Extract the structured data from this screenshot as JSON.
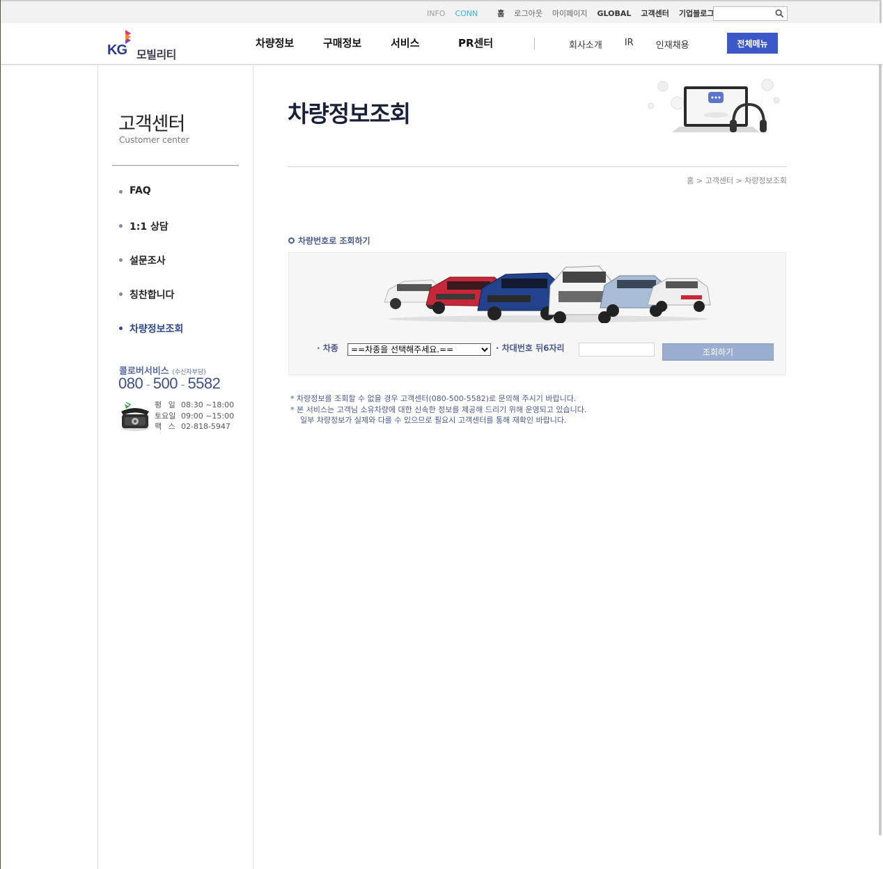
{
  "util_bar": {
    "infoconn_a": "INFO",
    "infoconn_b": "CONN",
    "links": [
      "홈",
      "로그아웃",
      "마이페이지",
      "GLOBAL",
      "고객센터",
      "기업블로그"
    ],
    "search_placeholder": ""
  },
  "header": {
    "logo_kg": "KG",
    "logo_brand": "모빌리티",
    "gnb": [
      "차량정보",
      "구매정보",
      "서비스",
      "PR센터"
    ],
    "sub_nav": [
      "회사소개",
      "IR",
      "인재채용"
    ],
    "all_menu": "전체메뉴"
  },
  "sidebar": {
    "title": "고객센터",
    "subtitle": "Customer center",
    "items": [
      {
        "label": "FAQ",
        "active": false
      },
      {
        "label": "1:1 상담",
        "active": false
      },
      {
        "label": "설문조사",
        "active": false
      },
      {
        "label": "칭찬합니다",
        "active": false
      },
      {
        "label": "차량정보조회",
        "active": true
      }
    ],
    "cs_label": "콜로버서비스",
    "cs_label_small": "(수신자부담)",
    "phone_a": "080",
    "phone_b": "500",
    "phone_c": "5582",
    "hours": [
      {
        "k": "평  일",
        "v": "08:30 ~18:00"
      },
      {
        "k": "토요일",
        "v": "09:00 ~15:00"
      },
      {
        "k": "팩  스",
        "v": "02-818-5947"
      }
    ]
  },
  "main": {
    "title": "차량정보조회",
    "breadcrumb": "홈 > 고객센터 > 차량정보조회",
    "section_heading": "차량번호로 조회하기",
    "lbl_type": "· 차종",
    "select_value": "==차종을 선택해주세요.==",
    "lbl_vin": "· 차대번호 뒤6자리",
    "vin_value": "",
    "btn_search": "조회하기",
    "notes": [
      "* 차량정보를 조회할 수 없을 경우 고객센터(080-500-5582)로 문의해 주시기 바랍니다.",
      "* 본 서비스는 고객님 소유차량에 대한 신속한 정보를 제공해 드리기 위해 운영되고 있습니다.",
      "일부 차량정보가 실제와 다를 수 있으므로 필요시 고객센터를 통해 재확인 바랍니다."
    ]
  },
  "colors": {
    "accent_blue": "#3c58c8",
    "nav_text_blue": "#4a5a8c",
    "button_blue": "#9aaed0"
  }
}
